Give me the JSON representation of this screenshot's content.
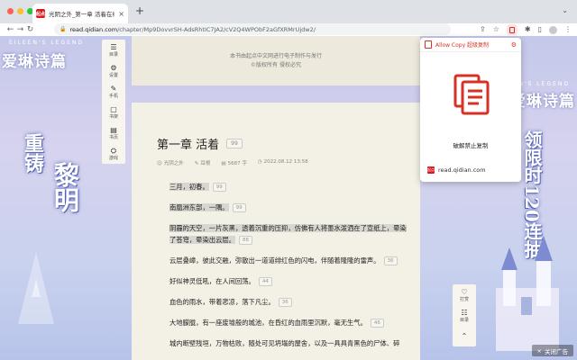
{
  "browser": {
    "tab_title": "光阴之外_第一章 活着在线免费阅",
    "tab_favicon": "起点",
    "tab_close": "×",
    "new_tab": "+",
    "tab_menu": "⌄",
    "url_host": "read.qidian.com",
    "url_path": "/chapter/Mp9DovvrSH-AdsRhtIC7JA2/cV2Q4WPObF2aGfXRMrUjdw2/",
    "nav_back": "←",
    "nav_forward": "→",
    "nav_reload": "↻",
    "toolbar_icons": [
      "share-icon",
      "bookmark-star-icon",
      "allow-copy-extension-icon",
      "puzzle-icon",
      "sidebar-icon",
      "profile-icon",
      "menu-icon"
    ],
    "dot_colors": [
      "#ff5f57",
      "#febc2e",
      "#28c840"
    ]
  },
  "banner": {
    "left_logo_cn": "爱琳诗篇",
    "left_logo_en": "EILEEN'S LEGEND",
    "left_slogan_1": "重铸",
    "left_slogan_2": "黎明",
    "right_logo_cn": "爱琳诗篇",
    "right_logo_en": "EILEEN'S LEGEND",
    "right_slogan": "领限时120连抽",
    "close_ad": "关闭广告",
    "close_ad_icon": "×"
  },
  "sidebar": {
    "items": [
      {
        "icon": "☰",
        "label": "目录"
      },
      {
        "icon": "⚙",
        "label": "设置"
      },
      {
        "icon": "✎",
        "label": "手机"
      },
      {
        "icon": "▢",
        "label": "书架"
      },
      {
        "icon": "▤",
        "label": "书页"
      },
      {
        "icon": "⛭",
        "label": "游戏"
      }
    ]
  },
  "header": {
    "line1": "本书由起点中文网进行电子制作与发行",
    "line2": "©版权所有 侵权必究"
  },
  "chapter": {
    "title": "第一章 活着",
    "title_count": "99",
    "author": "光阴之外",
    "author_icon": "☺",
    "author2": "耳根",
    "author2_icon": "✎",
    "words": "5687 字",
    "words_icon": "▤",
    "date": "2022.08.12 13:58",
    "date_icon": "◷",
    "paragraphs": [
      {
        "text": "三月，初春。",
        "count": "99",
        "hl": true
      },
      {
        "text": "南凰洲东部，一隅。",
        "count": "99",
        "hl": true
      },
      {
        "text": "阴霾的天空，一片灰黑，透着沉重的压抑，仿佛有人将墨水泼洒在了宣纸上，晕染了苍穹，晕染出云层。",
        "count": "88",
        "hl": true
      },
      {
        "text": "云层叠嶂，彼此交融，弥散出一道道绯红色的闪电，伴随着隆隆的雷声。",
        "count": "36",
        "hl": false
      },
      {
        "text": "好似神灵低吼，在人间回荡。",
        "count": "44",
        "hl": false
      },
      {
        "text": "血色的雨水，带着悲凉，落下凡尘。",
        "count": "36",
        "hl": false
      },
      {
        "text": "大地朦胧，有一座废墟般的城池，在昏红的血雨里沉默，毫无生气。",
        "count": "46",
        "hl": false
      },
      {
        "text": "城内断壁残垣，万物枯败，随处可见坍塌的屋舍，以及一具具青黑色的尸体、碎",
        "count": "",
        "hl": false
      }
    ]
  },
  "right_sidebar": {
    "items": [
      {
        "icon": "♡",
        "label": "打赏"
      },
      {
        "icon": "☷",
        "label": "目录"
      },
      {
        "icon": "⌃",
        "label": ""
      }
    ]
  },
  "popup": {
    "title": "Allow Copy 超级复制",
    "gear": "⚙",
    "status": "破解禁止复制",
    "site": "read.qidian.com",
    "site_favicon": "起点",
    "accent": "#d93025"
  }
}
